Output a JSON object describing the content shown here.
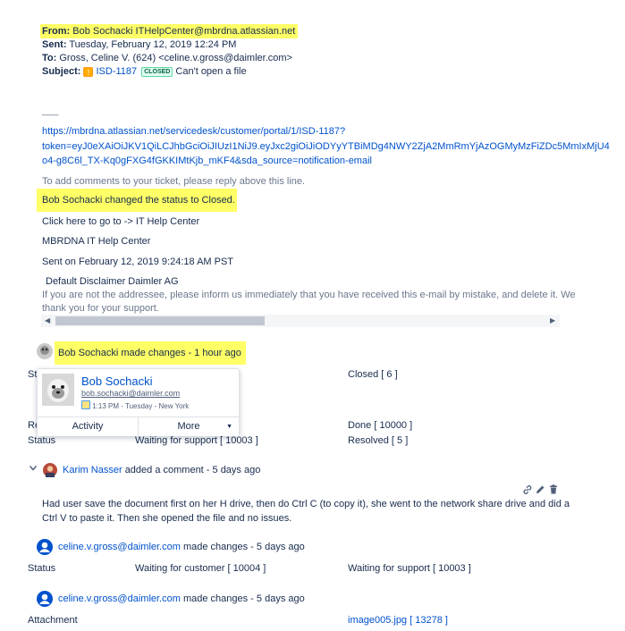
{
  "email": {
    "from_label": "From:",
    "from_value": "Bob Sochacki ITHelpCenter@mbrdna.atlassian.net",
    "sent_label": "Sent:",
    "sent_value": "Tuesday, February 12, 2019 12:24 PM",
    "to_label": "To:",
    "to_value": "Gross, Celine V. (624) <celine.v.gross@daimler.com>",
    "subject_label": "Subject:",
    "subject_issue_key": "ISD-1187",
    "subject_status": "CLOSED",
    "subject_text": "Can't open a file",
    "separator": "___",
    "portal_link_line1": "https://mbrdna.atlassian.net/servicedesk/customer/portal/1/ISD-1187?",
    "portal_link_line2": "token=eyJ0eXAiOiJKV1QiLCJhbGciOiJIUzI1NiJ9.eyJxc2giOiJiODYyYTBiMDg4NWY2ZjA2MmRmYjAzOGMyMzFiZDc5MmIxMjU4",
    "portal_link_line3": "o4-g8C6l_TX-Kq0gFXG4fGKKIMtKjb_mKF4&sda_source=notification-email",
    "reply_hint": "To add comments to your ticket, please reply above this line.",
    "status_changed": "Bob Sochacki changed the status to Closed.",
    "click_here": "Click here to go to -> IT Help Center",
    "help_center": "MBRDNA IT Help Center",
    "sent_on": "Sent on February 12, 2019 9:24:18 AM PST",
    "disclaimer_title": "Default Disclaimer Daimler AG",
    "disclaimer_line1": "If you are not the addressee, please inform us immediately that you have received this e-mail by mistake, and delete it. We",
    "disclaimer_line2": "thank you for your support."
  },
  "activity": {
    "made_changes": "Bob Sochacki made changes - 1 hour ago",
    "row1": {
      "label": "St",
      "value": "Closed [ 6 ]"
    },
    "row2": {
      "label": "Re",
      "value": "Done [ 10000 ]"
    },
    "row3": {
      "label": "Status",
      "from": "Waiting for support [ 10003 ]",
      "to": "Resolved [ 5 ]"
    },
    "comment_author": "Karim Nasser",
    "comment_meta": "added a comment - 5 days ago",
    "comment_line1": "Had user save the document first on her H drive, then do Ctrl C (to copy it), she went to the network share drive and did a",
    "comment_line2": "Ctrl V to paste it. Then she opened the file and no issues.",
    "change2_user": "celine.v.gross@daimler.com",
    "change2_meta": "made changes - 5 days ago",
    "change2_label": "Status",
    "change2_from": "Waiting for customer [ 10004 ]",
    "change2_to": "Waiting for support [ 10003 ]",
    "change3_user": "celine.v.gross@daimler.com",
    "change3_meta": "made changes - 5 days ago",
    "change3_label": "Attachment",
    "change3_to": "image005.jpg [ 13278 ]"
  },
  "hover_card": {
    "name": "Bob Sochacki",
    "email": "bob.sochacki@daimler.com",
    "local_time": "1:13 PM - Tuesday - New York",
    "activity_label": "Activity",
    "more_label": "More"
  },
  "colors": {
    "highlight": "#ffff66",
    "link": "#0052cc",
    "status_green": "#006644"
  }
}
